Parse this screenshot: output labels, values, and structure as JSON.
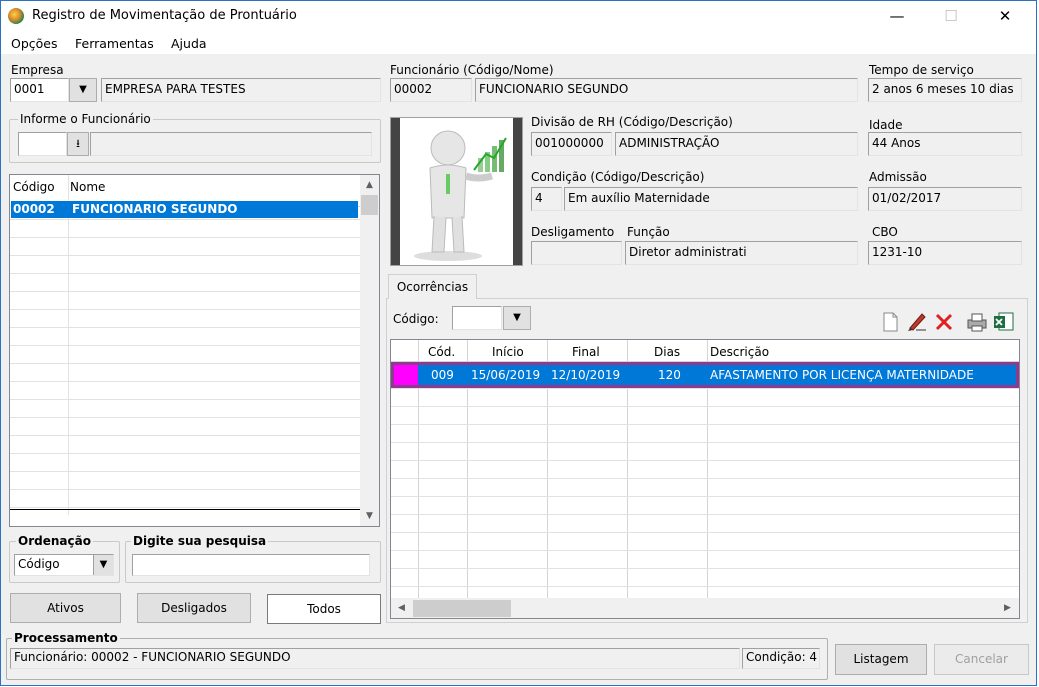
{
  "window": {
    "title": "Registro de Movimentação de Prontuário",
    "minimize": "—",
    "maximize": "☐",
    "close": "✕"
  },
  "menu": [
    "Opções",
    "Ferramentas",
    "Ajuda"
  ],
  "empresa": {
    "label": "Empresa",
    "code": "0001",
    "name": "EMPRESA PARA TESTES"
  },
  "funcionario": {
    "label": "Funcionário (Código/Nome)",
    "code": "00002",
    "name": "FUNCIONARIO SEGUNDO"
  },
  "tempo": {
    "label": "Tempo de serviço",
    "value": "2 anos 6 meses 10 dias"
  },
  "informe": {
    "label": "Informe o Funcionário"
  },
  "list": {
    "headers": [
      "Código",
      "Nome"
    ],
    "rows": [
      {
        "code": "00002",
        "name": "FUNCIONARIO SEGUNDO"
      }
    ]
  },
  "divisao": {
    "label": "Divisão de RH (Código/Descrição)",
    "code": "001000000",
    "desc": "ADMINISTRAÇÃO"
  },
  "idade": {
    "label": "Idade",
    "value": "44 Anos"
  },
  "condicao": {
    "label": "Condição (Código/Descrição)",
    "code": "4",
    "desc": "Em auxílio Maternidade"
  },
  "admissao": {
    "label": "Admissão",
    "value": "01/02/2017"
  },
  "desligamento": {
    "label": "Desligamento",
    "value": ""
  },
  "funcao": {
    "label": "Função",
    "value": "Diretor administrati"
  },
  "cbo": {
    "label": "CBO",
    "value": "1231-10"
  },
  "ocorrencias": {
    "tab": "Ocorrências",
    "codigo_label": "Código:",
    "headers": [
      "Cód.",
      "Início",
      "Final",
      "Dias",
      "Descrição"
    ],
    "rows": [
      {
        "cod": "009",
        "inicio": "15/06/2019",
        "final": "12/10/2019",
        "dias": "120",
        "descricao": "AFASTAMENTO POR LICENÇA MATERNIDADE"
      }
    ]
  },
  "ordenacao": {
    "label": "Ordenação",
    "value": "Código"
  },
  "pesquisa": {
    "label": "Digite sua pesquisa",
    "value": ""
  },
  "buttons": {
    "ativos": "Ativos",
    "desligados": "Desligados",
    "todos": "Todos",
    "listagem": "Listagem",
    "cancelar": "Cancelar"
  },
  "processamento": {
    "label": "Processamento",
    "status": "Funcionário: 00002 - FUNCIONARIO SEGUNDO",
    "condicao": "Condição: 4"
  },
  "colors": {
    "selection": "#0078d7",
    "highlight_border": "#8e3a8e",
    "marker": "#ff00ff"
  }
}
